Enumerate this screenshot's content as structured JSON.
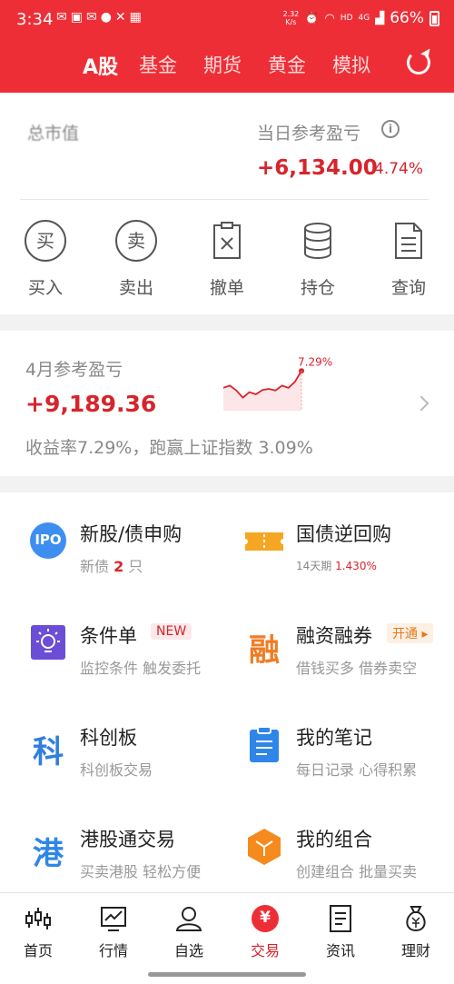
{
  "status_bar": {
    "time": "3:34",
    "speed_top": "2.32",
    "speed_bottom": "K/s",
    "hd": "HD",
    "net": "4G",
    "battery": "66%"
  },
  "nav": {
    "tabs": [
      "A股",
      "基金",
      "期货",
      "黄金",
      "模拟"
    ],
    "active_tab": "A股"
  },
  "summary": {
    "total_label": "总市值",
    "daily_label": "当日参考盈亏",
    "daily_pnl": "+6,134.00",
    "daily_pct": "4.74%",
    "actions": [
      "买入",
      "卖出",
      "撤单",
      "持仓",
      "查询"
    ],
    "action_glyphs": [
      "买",
      "卖"
    ]
  },
  "monthly": {
    "title": "4月参考盈亏",
    "pnl": "+9,189.36",
    "return_text": "收益率7.29%，跑赢上证指数 3.09%",
    "chart_peak_label": "7.29%"
  },
  "chart_data": {
    "type": "line",
    "series": [
      {
        "values": [
          4.2,
          4.6,
          3.7,
          2.4,
          3.4,
          3.0,
          3.8,
          4.0,
          3.7,
          4.6,
          4.2,
          5.3,
          7.29
        ]
      }
    ],
    "annotations": [
      "7.29%"
    ]
  },
  "features": [
    {
      "name": "新股/债申购",
      "desc_prefix": "新债 ",
      "desc_count": "2",
      "desc_suffix": " 只",
      "icon": "ipo-icon",
      "icon_text": "IPO"
    },
    {
      "name": "国债逆回购",
      "desc_prefix": "14天期 ",
      "desc_rate": "1.430%",
      "icon": "ticket-icon"
    },
    {
      "name": "条件单",
      "badge": "NEW",
      "desc": "监控条件 触发委托",
      "icon": "lightbulb-icon"
    },
    {
      "name": "融资融券",
      "badge": "开通",
      "desc": "借钱买多 借券卖空",
      "icon": "margin-icon",
      "icon_text": "融"
    },
    {
      "name": "科创板",
      "desc": "科创板交易",
      "icon": "star-market-icon",
      "icon_text": "科"
    },
    {
      "name": "我的笔记",
      "desc": "每日记录 心得积累",
      "icon": "note-icon"
    },
    {
      "name": "港股通交易",
      "desc": "买卖港股 轻松方便",
      "icon": "hk-connect-icon",
      "icon_text": "港"
    },
    {
      "name": "我的组合",
      "desc": "创建组合 批量买卖",
      "icon": "portfolio-icon"
    }
  ],
  "tabbar": {
    "items": [
      "首页",
      "行情",
      "自选",
      "交易",
      "资讯",
      "理财"
    ],
    "active": "交易",
    "trade_glyph": "¥"
  },
  "colors": {
    "brand": "#ee2e36",
    "positive": "#d7242c"
  }
}
